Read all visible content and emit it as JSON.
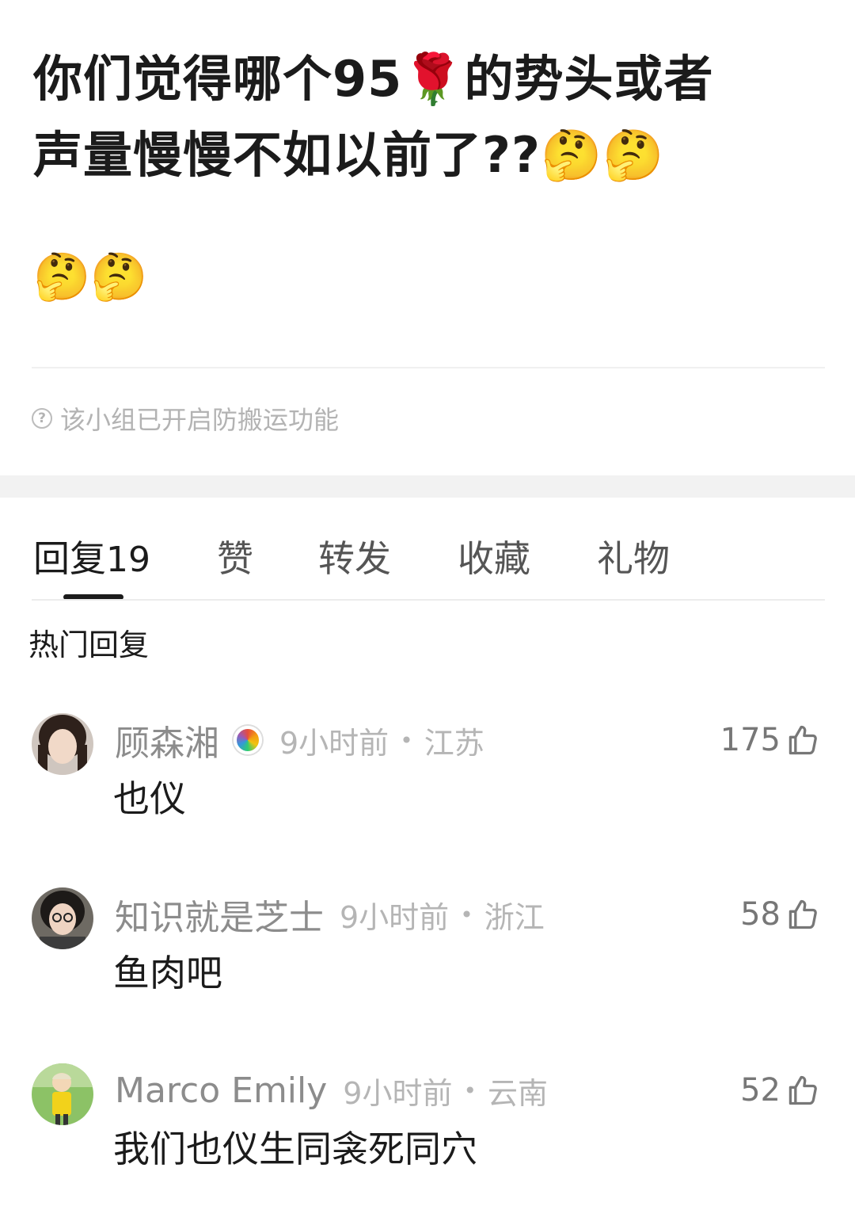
{
  "post": {
    "title_line1": "你们觉得哪个95",
    "title_rose": "🌹",
    "title_line1_tail": "的势头或者",
    "title_line2": "声量慢慢不如以前了??",
    "title_emoji_trail": "🤔🤔",
    "emoji_row": "🤔🤔",
    "notice": "该小组已开启防搬运功能",
    "notice_icon": "?"
  },
  "tabs": {
    "reply_label": "回复",
    "reply_count": "19",
    "like_label": "赞",
    "forward_label": "转发",
    "collect_label": "收藏",
    "gift_label": "礼物"
  },
  "section_title": "热门回复",
  "comments": [
    {
      "name": "顾森湘",
      "time": "9小时前",
      "location": "江苏",
      "text": "也仪",
      "likes": "175",
      "avatar_color": "#3a2a22"
    },
    {
      "name": "知识就是芝士",
      "time": "9小时前",
      "location": "浙江",
      "text": "鱼肉吧",
      "likes": "58",
      "avatar_color": "#2b2b2b"
    },
    {
      "name": "Marco Emily",
      "time": "9小时前",
      "location": "云南",
      "text": "我们也仪生同衾死同穴",
      "likes": "52",
      "avatar_color": "#7fb25a"
    }
  ],
  "meta_separator": "•",
  "icons": {
    "like": "thumbs-up-icon",
    "help": "question-circle-icon",
    "badge": "rainbow-badge-icon"
  }
}
